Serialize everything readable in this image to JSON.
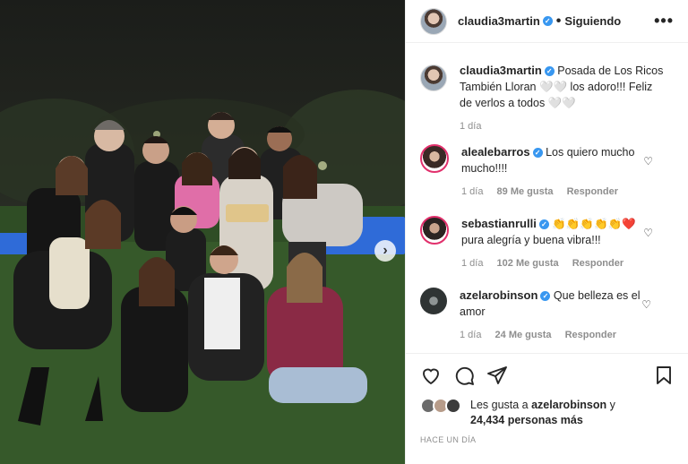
{
  "header": {
    "username": "claudia3martin",
    "separator": "•",
    "follow_label": "Siguiendo",
    "more_label": "•••",
    "verified_icon": "verified-badge-icon"
  },
  "caption": {
    "username": "claudia3martin",
    "text": "Posada de Los Ricos También Lloran 🤍🤍 los adoro!!! Feliz de verlos a todos 🤍🤍",
    "time": "1 día"
  },
  "comments": [
    {
      "username": "alealebarros",
      "text": "Los quiero mucho mucho!!!!",
      "time": "1 día",
      "likes": "89 Me gusta",
      "reply": "Responder"
    },
    {
      "username": "sebastianrulli",
      "text": "👏👏👏👏👏❤️ pura alegría y buena vibra!!!",
      "time": "1 día",
      "likes": "102 Me gusta",
      "reply": "Responder"
    },
    {
      "username": "azelarobinson",
      "text": "Que belleza es el amor",
      "time": "1 día",
      "likes": "24 Me gusta",
      "reply": "Responder"
    }
  ],
  "likes": {
    "prefix": "Les gusta a ",
    "user": "azelarobinson",
    "suffix": " y",
    "count_text": "24,434 personas más"
  },
  "posted_ago": "HACE UN DÍA",
  "photo": {
    "next_label": "›",
    "colors": {
      "sky": "#1b1d1a",
      "lawn": "#36592a",
      "pool": "#2f6bd8"
    }
  },
  "colors": {
    "accent": "#3897f0",
    "story_ring": "#e1306c",
    "muted": "#8e8e8e"
  }
}
